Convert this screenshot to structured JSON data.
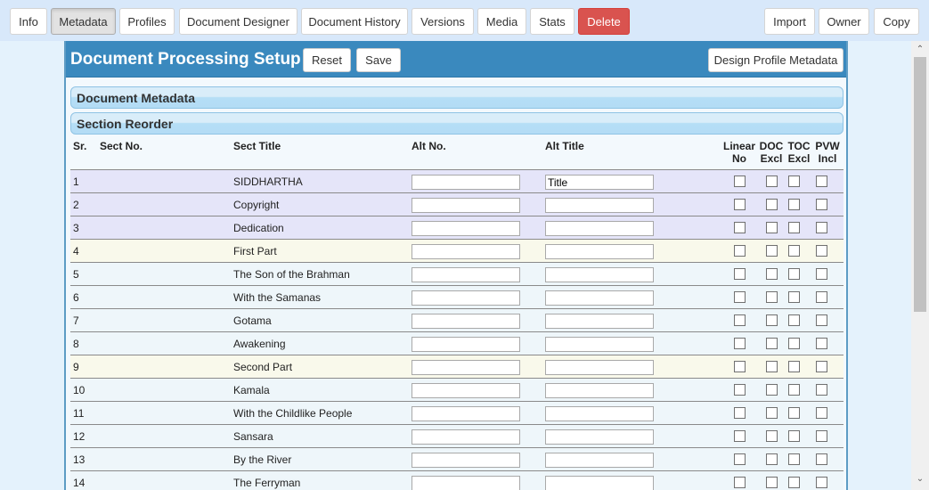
{
  "toolbar": {
    "left_buttons": [
      "Info",
      "Metadata",
      "Profiles",
      "Document Designer",
      "Document History",
      "Versions",
      "Media",
      "Stats",
      "Delete"
    ],
    "right_buttons": [
      "Import",
      "Owner",
      "Copy"
    ],
    "active_tab": "Metadata"
  },
  "panel": {
    "title": "Document Processing Setup",
    "reset_label": "Reset",
    "save_label": "Save",
    "design_profile_label": "Design Profile Metadata"
  },
  "accordions": {
    "metadata": "Document Metadata",
    "section_reorder": "Section Reorder"
  },
  "table": {
    "headers": {
      "sr": "Sr.",
      "sect_no": "Sect No.",
      "sect_title": "Sect Title",
      "alt_no": "Alt No.",
      "alt_title": "Alt Title",
      "linear_no": [
        "Linear",
        "No"
      ],
      "doc_excl": [
        "DOC",
        "Excl"
      ],
      "toc_excl": [
        "TOC",
        "Excl"
      ],
      "pvw_incl": [
        "PVW",
        "Incl"
      ]
    },
    "rows": [
      {
        "sr": "1",
        "sect_no": "",
        "title": "SIDDHARTHA",
        "alt_no": "",
        "alt_title": "Title",
        "type": "front",
        "linear_no": false,
        "doc_excl": false,
        "toc_excl": false,
        "pvw_incl": false
      },
      {
        "sr": "2",
        "sect_no": "",
        "title": "Copyright",
        "alt_no": "",
        "alt_title": "",
        "type": "front",
        "linear_no": false,
        "doc_excl": false,
        "toc_excl": false,
        "pvw_incl": false
      },
      {
        "sr": "3",
        "sect_no": "",
        "title": "Dedication",
        "alt_no": "",
        "alt_title": "",
        "type": "front",
        "linear_no": false,
        "doc_excl": false,
        "toc_excl": false,
        "pvw_incl": false
      },
      {
        "sr": "4",
        "sect_no": "",
        "title": "First Part",
        "alt_no": "",
        "alt_title": "",
        "type": "part",
        "linear_no": false,
        "doc_excl": false,
        "toc_excl": false,
        "pvw_incl": false
      },
      {
        "sr": "5",
        "sect_no": "",
        "title": "The Son of the Brahman",
        "alt_no": "",
        "alt_title": "",
        "type": "normal",
        "linear_no": false,
        "doc_excl": false,
        "toc_excl": false,
        "pvw_incl": false
      },
      {
        "sr": "6",
        "sect_no": "",
        "title": "With the Samanas",
        "alt_no": "",
        "alt_title": "",
        "type": "normal",
        "linear_no": false,
        "doc_excl": false,
        "toc_excl": false,
        "pvw_incl": false
      },
      {
        "sr": "7",
        "sect_no": "",
        "title": "Gotama",
        "alt_no": "",
        "alt_title": "",
        "type": "normal",
        "linear_no": false,
        "doc_excl": false,
        "toc_excl": false,
        "pvw_incl": false
      },
      {
        "sr": "8",
        "sect_no": "",
        "title": "Awakening",
        "alt_no": "",
        "alt_title": "",
        "type": "normal",
        "linear_no": false,
        "doc_excl": false,
        "toc_excl": false,
        "pvw_incl": false
      },
      {
        "sr": "9",
        "sect_no": "",
        "title": "Second Part",
        "alt_no": "",
        "alt_title": "",
        "type": "part",
        "linear_no": false,
        "doc_excl": false,
        "toc_excl": false,
        "pvw_incl": false
      },
      {
        "sr": "10",
        "sect_no": "",
        "title": "Kamala",
        "alt_no": "",
        "alt_title": "",
        "type": "normal",
        "linear_no": false,
        "doc_excl": false,
        "toc_excl": false,
        "pvw_incl": false
      },
      {
        "sr": "11",
        "sect_no": "",
        "title": "With the Childlike People",
        "alt_no": "",
        "alt_title": "",
        "type": "normal",
        "linear_no": false,
        "doc_excl": false,
        "toc_excl": false,
        "pvw_incl": false
      },
      {
        "sr": "12",
        "sect_no": "",
        "title": "Sansara",
        "alt_no": "",
        "alt_title": "",
        "type": "normal",
        "linear_no": false,
        "doc_excl": false,
        "toc_excl": false,
        "pvw_incl": false
      },
      {
        "sr": "13",
        "sect_no": "",
        "title": "By the River",
        "alt_no": "",
        "alt_title": "",
        "type": "normal",
        "linear_no": false,
        "doc_excl": false,
        "toc_excl": false,
        "pvw_incl": false
      },
      {
        "sr": "14",
        "sect_no": "",
        "title": "The Ferryman",
        "alt_no": "",
        "alt_title": "",
        "type": "normal",
        "linear_no": false,
        "doc_excl": false,
        "toc_excl": false,
        "pvw_incl": false
      }
    ]
  },
  "scrollbar": {
    "up_icon": "chevron-up-icon",
    "down_icon": "chevron-down-icon"
  }
}
